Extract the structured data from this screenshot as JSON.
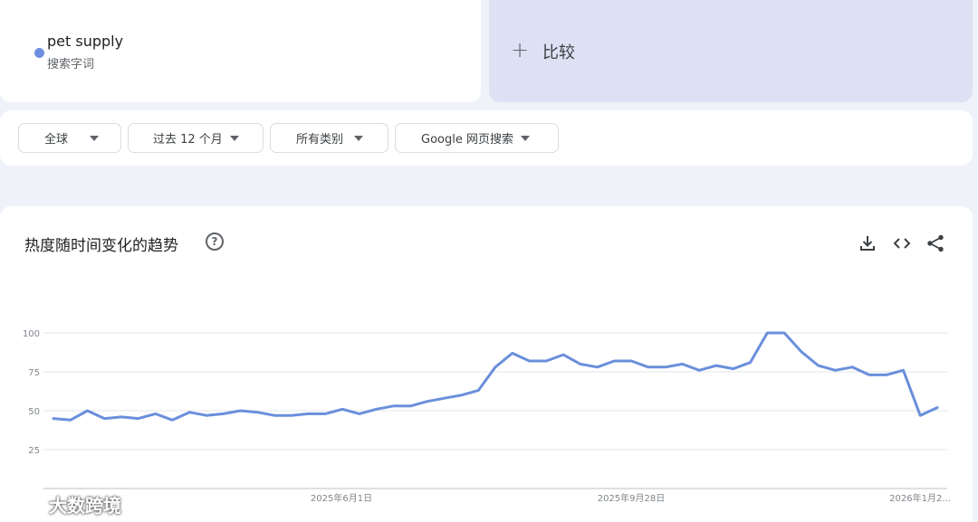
{
  "search_term": {
    "name": "pet supply",
    "type_label": "搜索字词",
    "color": "#6e8fdf"
  },
  "compare": {
    "icon": "plus-icon",
    "label": "比较"
  },
  "filters": [
    {
      "label": "全球"
    },
    {
      "label": "过去 12 个月"
    },
    {
      "label": "所有类别"
    },
    {
      "label": "Google 网页搜索"
    }
  ],
  "chart_panel": {
    "title": "热度随时间变化的趋势",
    "help_icon": "help-circle-icon",
    "actions": [
      "download-icon",
      "embed-code-icon",
      "share-icon"
    ]
  },
  "chart_data": {
    "type": "line",
    "title": "",
    "xlabel": "",
    "ylabel": "",
    "ylim": [
      0,
      100
    ],
    "yticks": [
      25,
      50,
      75,
      100
    ],
    "grid": true,
    "x_tick_labels": [
      "2025年6月1日",
      "2025年9月28日",
      "2026年1月2..."
    ],
    "line_color": "#6a8fdb",
    "series": [
      {
        "values": [
          45,
          44,
          50,
          45,
          46,
          45,
          48,
          44,
          49,
          47,
          48,
          50,
          49,
          47,
          47,
          48,
          48,
          51,
          48,
          51,
          53,
          53,
          56,
          58,
          60,
          63,
          78,
          87,
          82,
          82,
          86,
          80,
          78,
          82,
          82,
          78,
          78,
          80,
          76,
          79,
          77,
          81,
          100,
          100,
          88,
          79,
          76,
          78,
          73,
          73,
          76,
          47,
          52
        ]
      }
    ]
  },
  "watermark": {
    "text": "大数跨境"
  }
}
